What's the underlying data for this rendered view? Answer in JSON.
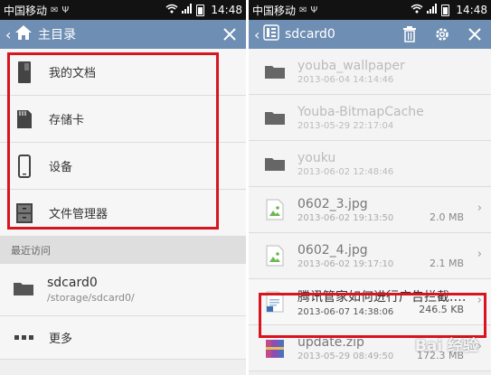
{
  "left": {
    "status": {
      "carrier": "中国移动",
      "time": "14:48"
    },
    "title": "主目录",
    "menu": [
      {
        "label": "我的文档",
        "icon": "document-icon"
      },
      {
        "label": "存储卡",
        "icon": "sd-card-icon"
      },
      {
        "label": "设备",
        "icon": "phone-device-icon"
      },
      {
        "label": "文件管理器",
        "icon": "file-cabinet-icon"
      }
    ],
    "recent_header": "最近访问",
    "recent": {
      "name": "sdcard0",
      "path": "/storage/sdcard0/"
    },
    "more_label": "更多"
  },
  "right": {
    "status": {
      "carrier": "中国移动",
      "time": "14:48"
    },
    "title": "sdcard0",
    "files": [
      {
        "name": "youba_wallpaper",
        "date": "2013-06-04 14:14:46",
        "size": "",
        "type": "folder"
      },
      {
        "name": "Youba-BitmapCache",
        "date": "2013-05-29 22:17:04",
        "size": "",
        "type": "folder"
      },
      {
        "name": "youku",
        "date": "2013-06-02 12:48:46",
        "size": "",
        "type": "folder"
      },
      {
        "name": "0602_3.jpg",
        "date": "2013-06-02 19:13:50",
        "size": "2.0 MB",
        "type": "image"
      },
      {
        "name": "0602_4.jpg",
        "date": "2013-06-02 19:17:10",
        "size": "2.1 MB",
        "type": "image"
      },
      {
        "name": "腾讯管家如何进行广告拦截.d...",
        "date": "2013-06-07 14:38:06",
        "size": "246.5 KB",
        "type": "doc"
      },
      {
        "name": "update.zip",
        "date": "2013-05-29 08:49:50",
        "size": "172.3 MB",
        "type": "zip"
      }
    ],
    "watermark": "Bai 经验"
  },
  "colors": {
    "titlebar": "#6f8eb3",
    "highlight": "#d8141f",
    "statusbar": "#121212"
  }
}
